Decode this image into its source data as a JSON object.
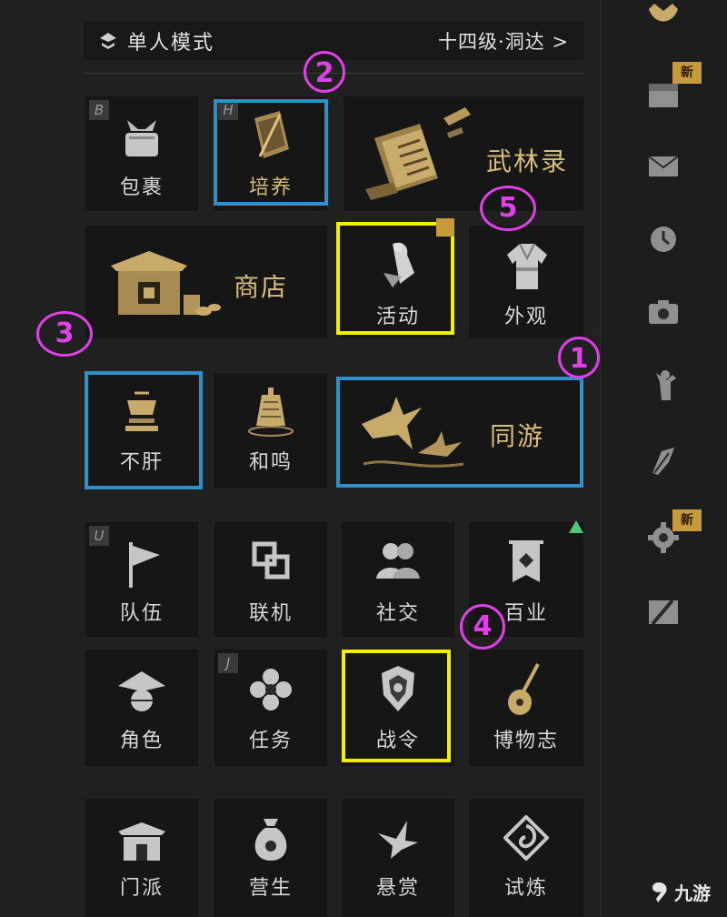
{
  "header": {
    "mode_label": "单人模式",
    "level_label": "十四级·洞达 >"
  },
  "tiles": {
    "baoguo": {
      "label": "包裹",
      "hotkey": "B"
    },
    "peiyang": {
      "label": "培养",
      "hotkey": "H"
    },
    "wulinlu": {
      "label": "武林录"
    },
    "shangdian": {
      "label": "商店"
    },
    "huodong": {
      "label": "活动"
    },
    "waiguan": {
      "label": "外观"
    },
    "bugan": {
      "label": "不肝"
    },
    "heming": {
      "label": "和鸣"
    },
    "tongyou": {
      "label": "同游"
    },
    "duiwu": {
      "label": "队伍",
      "hotkey": "U"
    },
    "lianji": {
      "label": "联机"
    },
    "shejiao": {
      "label": "社交"
    },
    "baiye": {
      "label": "百业"
    },
    "juese": {
      "label": "角色"
    },
    "renwu": {
      "label": "任务",
      "hotkey": "J"
    },
    "zhanling": {
      "label": "战令"
    },
    "bowuzhi": {
      "label": "博物志"
    },
    "menpai": {
      "label": "门派"
    },
    "yingsheng": {
      "label": "营生"
    },
    "xuanshang": {
      "label": "悬赏"
    },
    "shilian": {
      "label": "试炼"
    }
  },
  "annotations": {
    "n1": "1",
    "n2": "2",
    "n3": "3",
    "n4": "4",
    "n5": "5"
  },
  "sidebar": {
    "new_badge_1": "新",
    "new_badge_2": "新"
  },
  "watermark": {
    "text": "九游"
  },
  "colors": {
    "gold": "#d9bd7a",
    "magenta": "#e040e8",
    "blue": "#2f8fc8",
    "yellow": "#f2f000"
  }
}
